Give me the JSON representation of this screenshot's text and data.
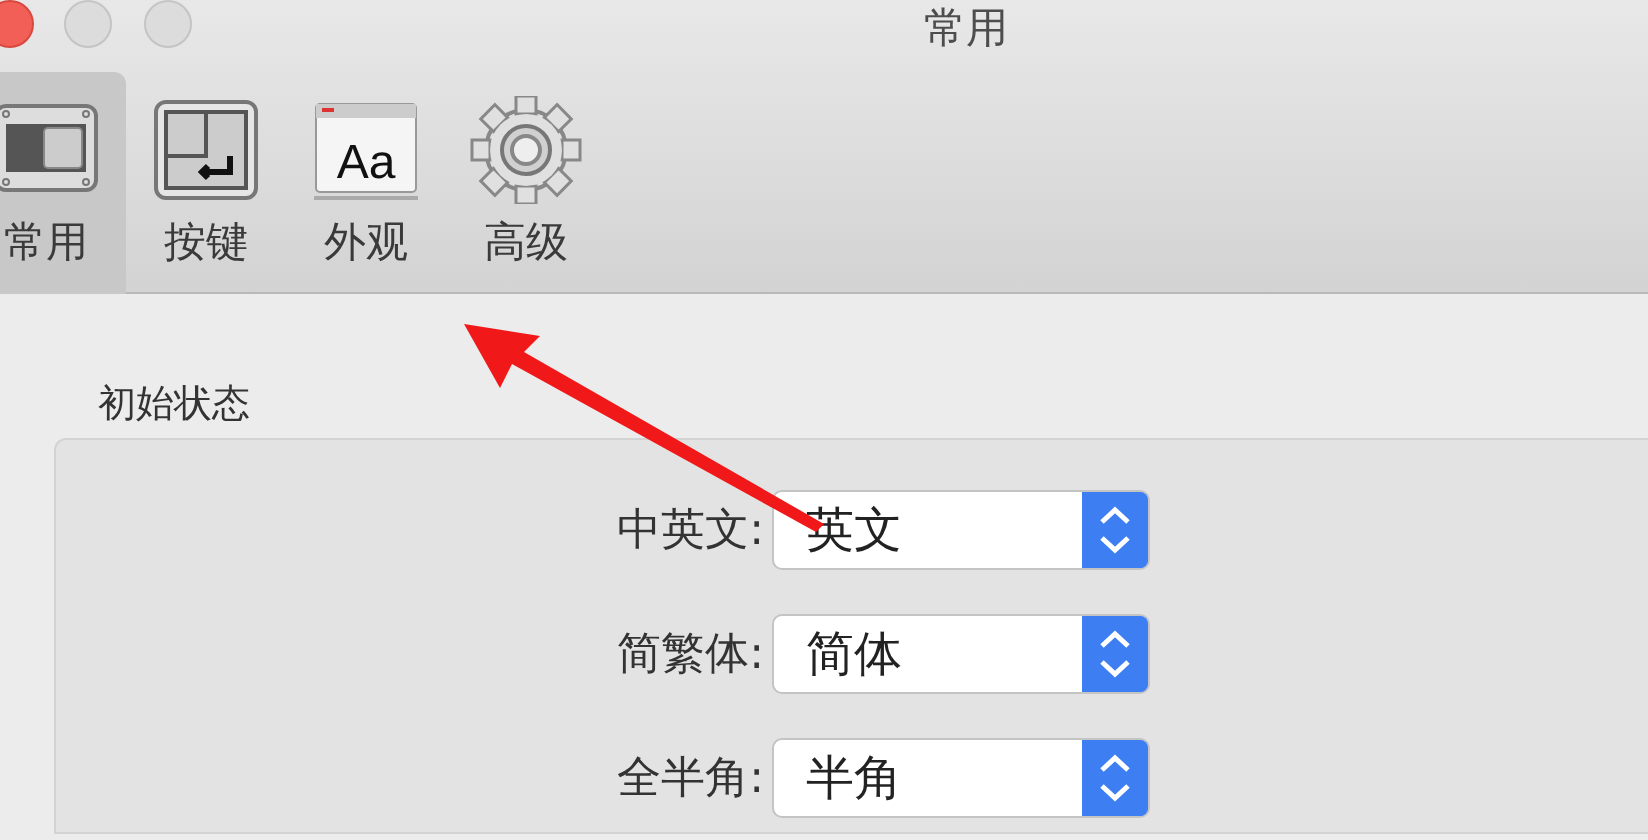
{
  "window": {
    "title": "常用"
  },
  "toolbar": {
    "tabs": [
      {
        "label": "常用",
        "selected": true
      },
      {
        "label": "按键",
        "selected": false
      },
      {
        "label": "外观",
        "selected": false,
        "icon_text": "Aa"
      },
      {
        "label": "高级",
        "selected": false
      }
    ]
  },
  "group": {
    "title": "初始状态",
    "fields": [
      {
        "label": "中英文:",
        "value": "英文"
      },
      {
        "label": "简繁体:",
        "value": "简体"
      },
      {
        "label": "全半角:",
        "value": "半角"
      }
    ]
  }
}
